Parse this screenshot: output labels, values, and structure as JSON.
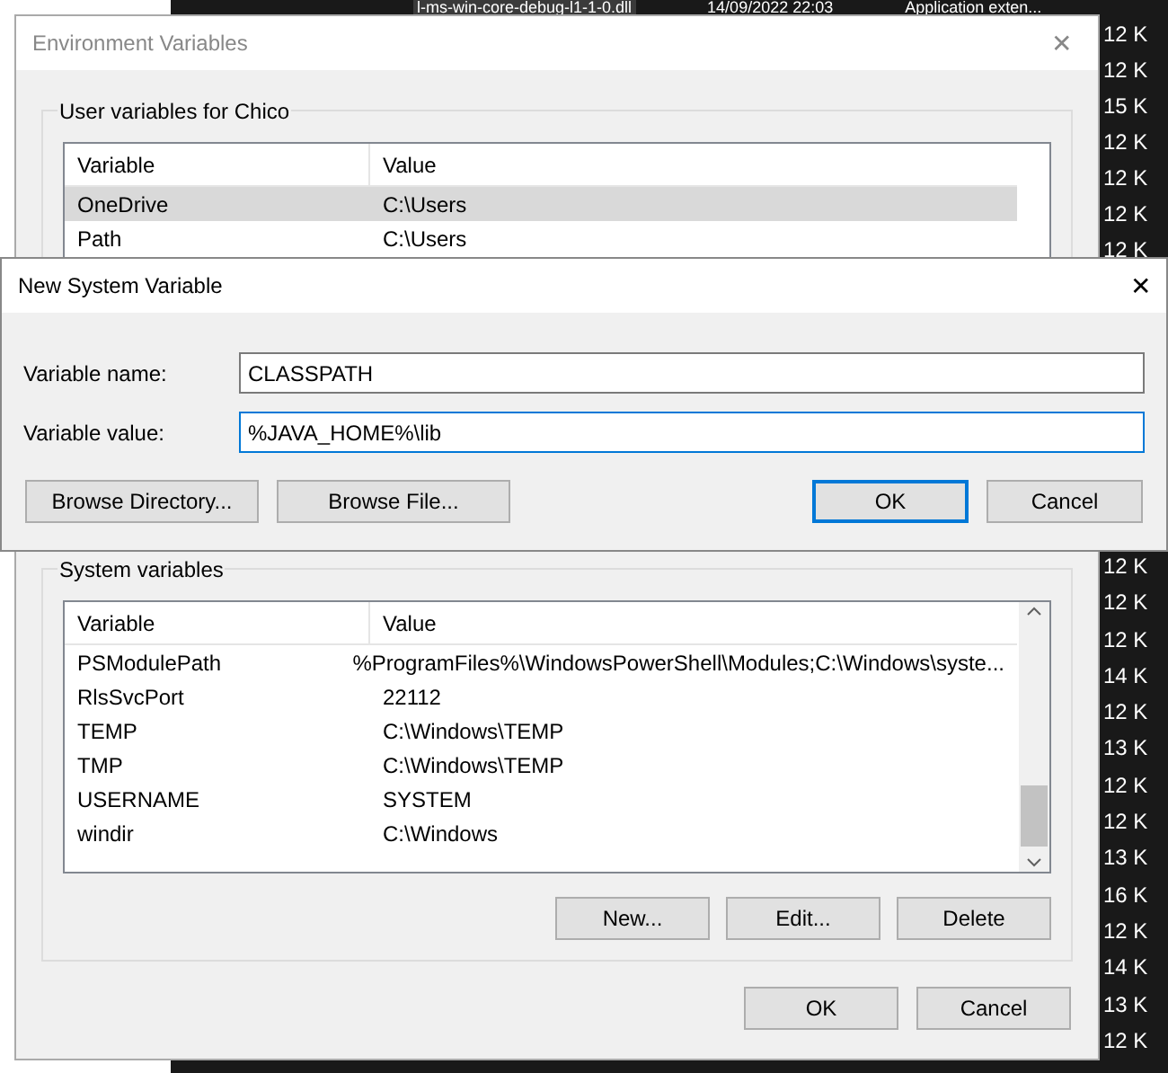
{
  "background_window": {
    "top_row": {
      "name": "l-ms-win-core-debug-l1-1-0.dll",
      "date": "14/09/2022 22:03",
      "type": "Application exten..."
    },
    "sizes_top": [
      "12 K",
      "12 K",
      "15 K",
      "12 K",
      "12 K",
      "12 K",
      "12 K"
    ],
    "sizes_bottom": [
      "12 K",
      "12 K",
      "12 K",
      "14 K",
      "12 K",
      "13 K",
      "12 K",
      "12 K",
      "13 K",
      "16 K",
      "12 K",
      "14 K",
      "13 K",
      "12 K"
    ]
  },
  "environment_dialog": {
    "title": "Environment Variables",
    "close": "✕",
    "user_group": {
      "label": "User variables for Chico",
      "columns": [
        "Variable",
        "Value"
      ],
      "rows": [
        {
          "variable": "OneDrive",
          "value": "C:\\Users",
          "selected": true
        },
        {
          "variable": "Path",
          "value": "C:\\Users",
          "selected": false
        }
      ]
    },
    "system_group": {
      "label": "System variables",
      "columns": [
        "Variable",
        "Value"
      ],
      "rows": [
        {
          "variable": "PSModulePath",
          "value": "%ProgramFiles%\\WindowsPowerShell\\Modules;C:\\Windows\\syste...",
          "selected": false
        },
        {
          "variable": "RlsSvcPort",
          "value": "22112",
          "selected": false
        },
        {
          "variable": "TEMP",
          "value": "C:\\Windows\\TEMP",
          "selected": false
        },
        {
          "variable": "TMP",
          "value": "C:\\Windows\\TEMP",
          "selected": false
        },
        {
          "variable": "USERNAME",
          "value": "SYSTEM",
          "selected": false
        },
        {
          "variable": "windir",
          "value": "C:\\Windows",
          "selected": false
        }
      ],
      "buttons": [
        "New...",
        "Edit...",
        "Delete"
      ]
    },
    "buttons": [
      "OK",
      "Cancel"
    ]
  },
  "new_variable_dialog": {
    "title": "New System Variable",
    "close": "✕",
    "fields": [
      {
        "label": "Variable name:",
        "value": "CLASSPATH",
        "focused": false
      },
      {
        "label": "Variable value:",
        "value": "%JAVA_HOME%\\lib",
        "focused": true
      }
    ],
    "buttons": [
      {
        "label": "Browse Directory...",
        "default": false
      },
      {
        "label": "Browse File...",
        "default": false
      },
      {
        "label": "OK",
        "default": true
      },
      {
        "label": "Cancel",
        "default": false
      }
    ]
  }
}
